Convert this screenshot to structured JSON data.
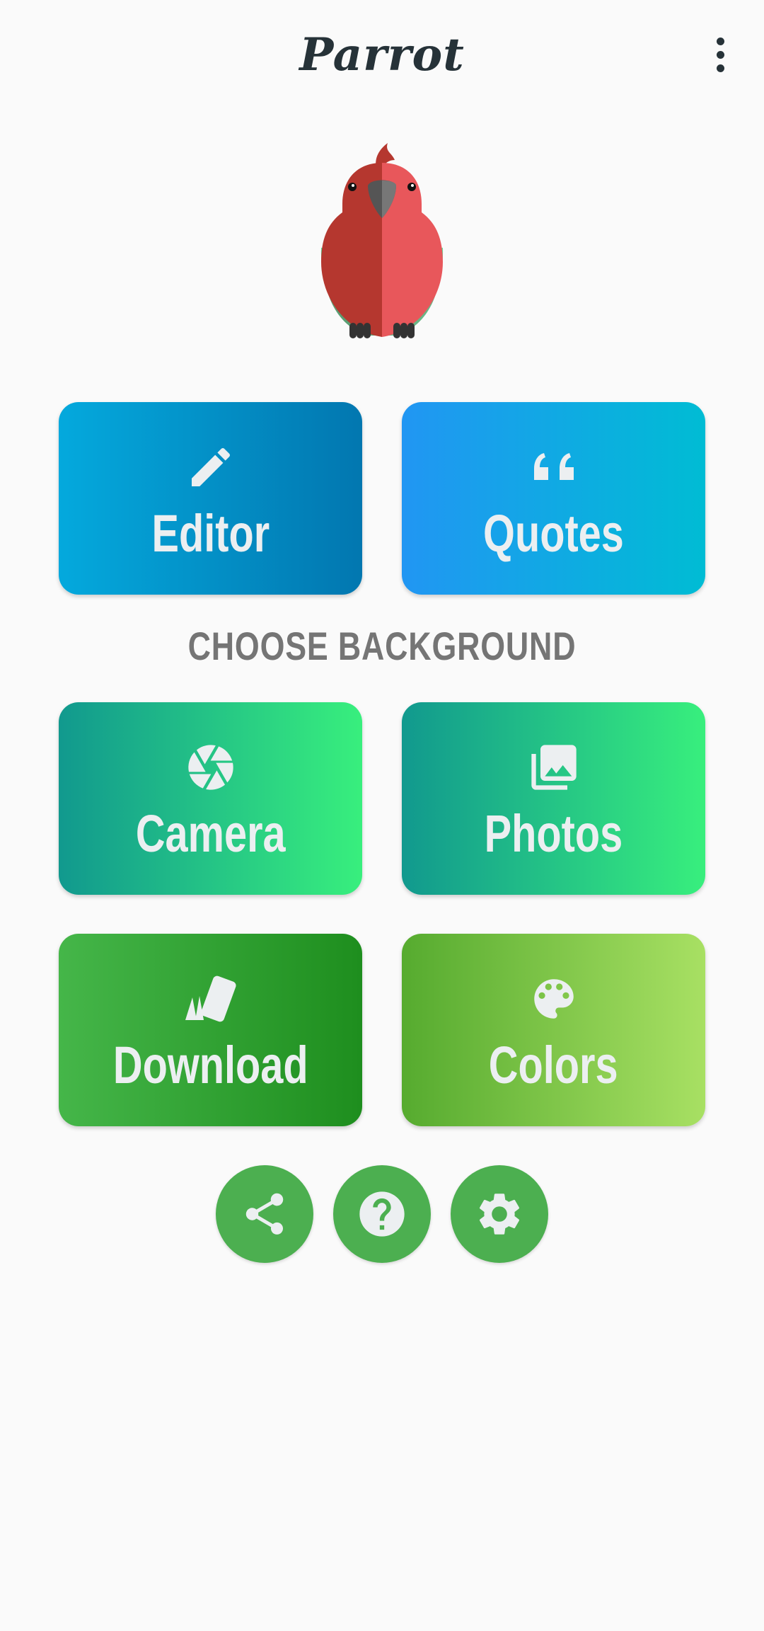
{
  "app": {
    "title": "Parrot"
  },
  "toolbar": {
    "menu_icon": "more-vertical-icon"
  },
  "logo": {
    "icon": "parrot-logo",
    "colors": {
      "body_dark": "#b5372f",
      "body_light": "#e8575b",
      "wing": "#5ee089",
      "beak": "#666666"
    }
  },
  "tiles_top": [
    {
      "label": "Editor",
      "icon": "pencil-icon",
      "colors": [
        "#04a9dd",
        "#0277b0"
      ]
    },
    {
      "label": "Quotes",
      "icon": "quote-icon",
      "colors": [
        "#2196f3",
        "#00bcd4"
      ]
    }
  ],
  "section": {
    "heading": "CHOOSE BACKGROUND"
  },
  "tiles_bottom": [
    {
      "label": "Camera",
      "icon": "camera-aperture-icon",
      "colors": [
        "#11998e",
        "#38ef7d"
      ]
    },
    {
      "label": "Photos",
      "icon": "photo-library-icon",
      "colors": [
        "#11998e",
        "#38ef7d"
      ]
    },
    {
      "label": "Download",
      "icon": "download-cards-icon",
      "colors": [
        "#45b649",
        "#1e8e1e"
      ]
    },
    {
      "label": "Colors",
      "icon": "palette-icon",
      "colors": [
        "#56ab2f",
        "#a8e063"
      ]
    }
  ],
  "bottom_actions": [
    {
      "icon": "share-icon"
    },
    {
      "icon": "help-icon"
    },
    {
      "icon": "settings-gear-icon"
    }
  ],
  "accent_color": "#4caf50"
}
